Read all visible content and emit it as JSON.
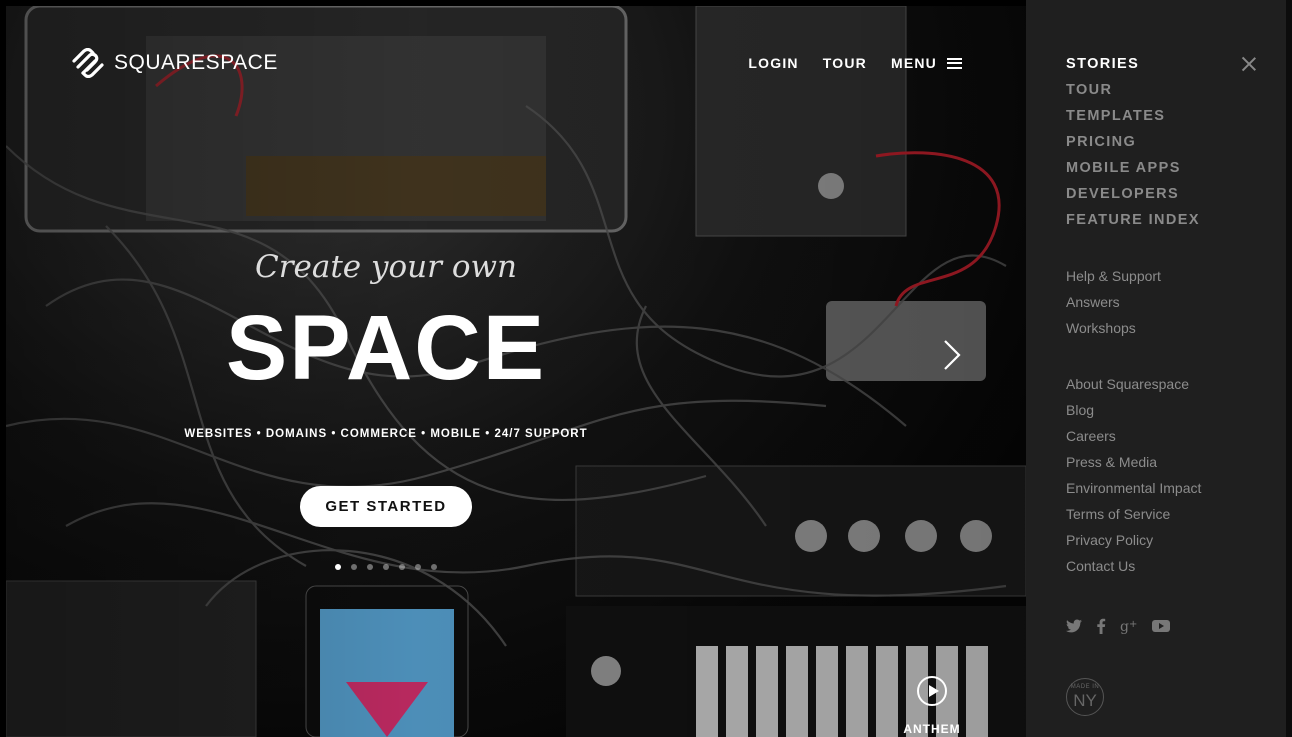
{
  "brand": {
    "name": "SQUARESPACE",
    "logo_icon": "squarespace-logo-icon"
  },
  "topnav": {
    "login": "LOGIN",
    "tour": "TOUR",
    "menu": "MENU",
    "menu_icon": "hamburger-icon"
  },
  "hero": {
    "tagline_small": "Create your own",
    "tagline_big": "SPACE",
    "services": "WEBSITES • DOMAINS • COMMERCE • MOBILE • 24/7 SUPPORT",
    "cta": "GET STARTED",
    "slides_total": 7,
    "slide_active": 1,
    "next_icon": "chevron-right-icon",
    "anthem_label": "ANTHEM",
    "play_icon": "play-icon"
  },
  "side_menu": {
    "close_icon": "close-icon",
    "primary": [
      {
        "label": "STORIES",
        "active": true
      },
      {
        "label": "TOUR",
        "active": false
      },
      {
        "label": "TEMPLATES",
        "active": false
      },
      {
        "label": "PRICING",
        "active": false
      },
      {
        "label": "MOBILE APPS",
        "active": false
      },
      {
        "label": "DEVELOPERS",
        "active": false
      },
      {
        "label": "FEATURE INDEX",
        "active": false
      }
    ],
    "support": [
      "Help & Support",
      "Answers",
      "Workshops"
    ],
    "company": [
      "About Squarespace",
      "Blog",
      "Careers",
      "Press & Media",
      "Environmental Impact",
      "Terms of Service",
      "Privacy Policy",
      "Contact Us"
    ],
    "social": [
      "twitter-icon",
      "facebook-icon",
      "google-plus-icon",
      "youtube-icon"
    ],
    "badge": {
      "small": "MADE IN",
      "big": "NY"
    }
  }
}
